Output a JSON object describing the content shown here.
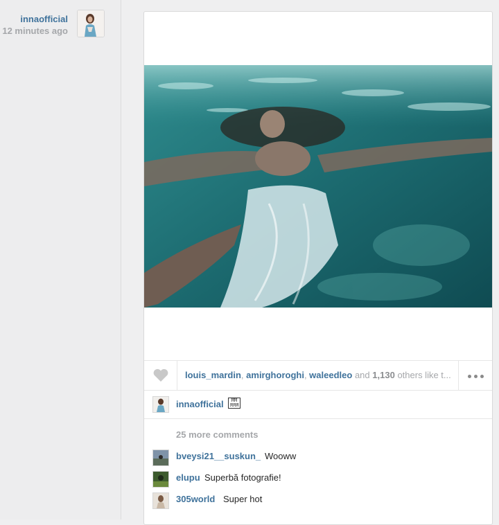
{
  "post": {
    "author": "innaofficial",
    "time_ago": "12 minutes ago",
    "likers": [
      "louis_mardin",
      "amirghoroghi",
      "waleedleo"
    ],
    "likes_and_text": "and",
    "likes_count": "1,130",
    "likes_suffix": "others like t...",
    "caption_user": "innaofficial",
    "caption_glyph": "ĦĦ ЯЯЯ",
    "more_comments": "25 more comments",
    "comments": [
      {
        "user": "bveysi21__suskun_",
        "text": "Wooww"
      },
      {
        "user": "elupu",
        "text": "Superbă fotografie!"
      },
      {
        "user": "305world",
        "text": "Super hot"
      }
    ]
  },
  "colors": {
    "link": "#3f729b",
    "muted": "#a5a7aa"
  },
  "icons": {
    "like": "heart-icon",
    "more": "ellipsis-icon"
  }
}
